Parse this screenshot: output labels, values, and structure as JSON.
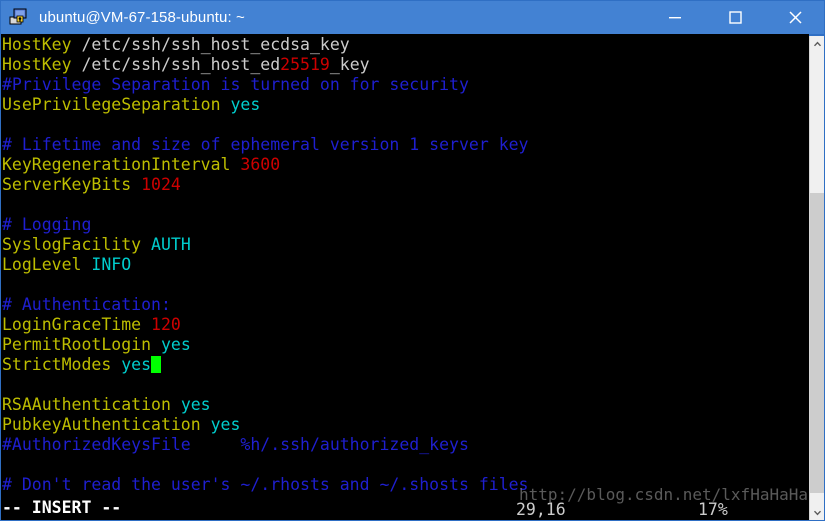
{
  "window": {
    "title": "ubuntu@VM-67-158-ubuntu: ~",
    "app_icon": "putty-icon",
    "buttons": {
      "minimize": "minimize-button",
      "maximize": "maximize-button",
      "close": "close-button"
    },
    "title_bar_color": "#4382d3"
  },
  "terminal": {
    "background": "#000000",
    "colors": {
      "keyword": "#bdbd00",
      "value": "#00cdcd",
      "number": "#cd0000",
      "comment": "#1f1fd0",
      "path": "#cccccc",
      "cursor": "#00ff00"
    },
    "lines": [
      {
        "id": "l1",
        "segments": [
          {
            "t": "HostKey ",
            "c": "kw"
          },
          {
            "t": "/etc/ssh/ssh_host_ecdsa_key",
            "c": "pth"
          }
        ]
      },
      {
        "id": "l2",
        "segments": [
          {
            "t": "HostKey ",
            "c": "kw"
          },
          {
            "t": "/etc/ssh/ssh_host_ed",
            "c": "pth"
          },
          {
            "t": "25519",
            "c": "num"
          },
          {
            "t": "_key",
            "c": "pth"
          }
        ]
      },
      {
        "id": "l3",
        "segments": [
          {
            "t": "#Privilege Separation is turned on for security",
            "c": "cmt"
          }
        ]
      },
      {
        "id": "l4",
        "segments": [
          {
            "t": "UsePrivilegeSeparation ",
            "c": "kw"
          },
          {
            "t": "yes",
            "c": "val"
          }
        ]
      },
      {
        "id": "l5",
        "segments": [
          {
            "t": "",
            "c": "pth"
          }
        ]
      },
      {
        "id": "l6",
        "segments": [
          {
            "t": "# Lifetime and size of ephemeral version 1 server key",
            "c": "cmt"
          }
        ]
      },
      {
        "id": "l7",
        "segments": [
          {
            "t": "KeyRegenerationInterval ",
            "c": "kw"
          },
          {
            "t": "3600",
            "c": "num"
          }
        ]
      },
      {
        "id": "l8",
        "segments": [
          {
            "t": "ServerKeyBits ",
            "c": "kw"
          },
          {
            "t": "1024",
            "c": "num"
          }
        ]
      },
      {
        "id": "l9",
        "segments": [
          {
            "t": "",
            "c": "pth"
          }
        ]
      },
      {
        "id": "l10",
        "segments": [
          {
            "t": "# Logging",
            "c": "cmt"
          }
        ]
      },
      {
        "id": "l11",
        "segments": [
          {
            "t": "SyslogFacility ",
            "c": "kw"
          },
          {
            "t": "AUTH",
            "c": "val"
          }
        ]
      },
      {
        "id": "l12",
        "segments": [
          {
            "t": "LogLevel ",
            "c": "kw"
          },
          {
            "t": "INFO",
            "c": "val"
          }
        ]
      },
      {
        "id": "l13",
        "segments": [
          {
            "t": "",
            "c": "pth"
          }
        ]
      },
      {
        "id": "l14",
        "segments": [
          {
            "t": "# Authentication:",
            "c": "cmt"
          }
        ]
      },
      {
        "id": "l15",
        "segments": [
          {
            "t": "LoginGraceTime ",
            "c": "kw"
          },
          {
            "t": "120",
            "c": "num"
          }
        ]
      },
      {
        "id": "l16",
        "segments": [
          {
            "t": "PermitRootLogin ",
            "c": "kw"
          },
          {
            "t": "yes",
            "c": "val"
          }
        ]
      },
      {
        "id": "l17",
        "segments": [
          {
            "t": "StrictModes ",
            "c": "kw"
          },
          {
            "t": "yes",
            "c": "val"
          },
          {
            "t": "",
            "c": "cursor"
          }
        ]
      },
      {
        "id": "l18",
        "segments": [
          {
            "t": "",
            "c": "pth"
          }
        ]
      },
      {
        "id": "l19",
        "segments": [
          {
            "t": "RSAAuthentication ",
            "c": "kw"
          },
          {
            "t": "yes",
            "c": "val"
          }
        ]
      },
      {
        "id": "l20",
        "segments": [
          {
            "t": "PubkeyAuthentication ",
            "c": "kw"
          },
          {
            "t": "yes",
            "c": "val"
          }
        ]
      },
      {
        "id": "l21",
        "segments": [
          {
            "t": "#AuthorizedKeysFile     %h/.ssh/authorized_keys",
            "c": "cmt"
          }
        ]
      },
      {
        "id": "l22",
        "segments": [
          {
            "t": "",
            "c": "pth"
          }
        ]
      },
      {
        "id": "l23",
        "segments": [
          {
            "t": "# Don't read the user's ~/.rhosts and ~/.shosts files",
            "c": "cmt"
          }
        ]
      }
    ],
    "status_line": "-- INSERT --",
    "ruler_position": "29,16",
    "ruler_percent": "17%"
  },
  "watermark": {
    "text": "http://blog.csdn.net/lxfHaHaHa"
  },
  "scrollbar": {
    "up_arrow": "scroll-up-arrow",
    "down_arrow": "scroll-down-arrow",
    "thumb": "scroll-thumb"
  }
}
